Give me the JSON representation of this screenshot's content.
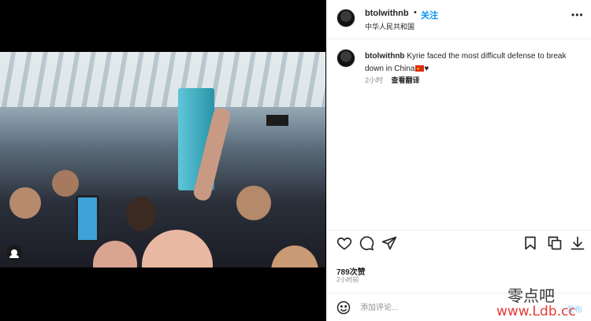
{
  "post": {
    "username": "btolwithnb",
    "separator": "•",
    "follow_label": "关注",
    "location": "中华人民共和国",
    "more_label": "•••"
  },
  "caption": {
    "username": "btolwithnb",
    "text": "Kyrie faced the most difficult defense to break down in China",
    "trailing": "♥",
    "time": "2小时",
    "translate_label": "查看翻译"
  },
  "stats": {
    "likes": "789次赞",
    "time_ago": "2小时前"
  },
  "comment": {
    "placeholder": "添加评论...",
    "post_label": "发布"
  },
  "watermark": {
    "line1": "零点吧",
    "line2": "www.Ldb.cc"
  },
  "colors": {
    "accent": "#0095f6",
    "post_disabled": "#b2dffc",
    "watermark_red": "#e53935"
  },
  "icons": [
    "heart-icon",
    "comment-icon",
    "share-icon",
    "bookmark-icon",
    "copy-icon",
    "download-icon",
    "emoji-icon",
    "tag-person-icon",
    "more-icon"
  ]
}
